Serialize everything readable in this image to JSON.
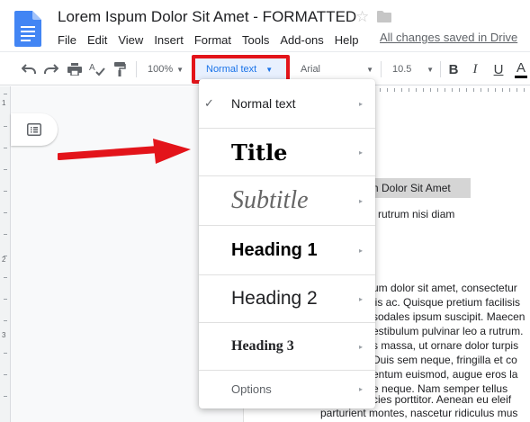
{
  "app": {
    "doc_title": "Lorem Ispum Dolor Sit Amet - FORMATTED",
    "save_status": "All changes saved in Drive",
    "logo_icon": "google-docs-logo",
    "colors": {
      "accent": "#1a73e8",
      "highlight_border": "#e3141a",
      "arrow": "#e3141a",
      "logo": "#4285f4"
    }
  },
  "menubar": [
    "File",
    "Edit",
    "View",
    "Insert",
    "Format",
    "Tools",
    "Add-ons",
    "Help"
  ],
  "toolbar": {
    "zoom": "100%",
    "style": "Normal text",
    "font": "Arial",
    "font_size": "10.5",
    "bold_label": "B",
    "italic_label": "I",
    "underline_label": "U",
    "text_color_label": "A"
  },
  "ruler": {
    "vertical_labels": [
      "1",
      "2",
      "3"
    ]
  },
  "style_menu": {
    "items": [
      {
        "label": "Normal text",
        "checked": true
      },
      {
        "label": "Title"
      },
      {
        "label": "Subtitle"
      },
      {
        "label": "Heading 1"
      },
      {
        "label": "Heading 2"
      },
      {
        "label": "Heading 3"
      },
      {
        "label": "Options"
      }
    ],
    "check_icon": "✓",
    "submenu_icon": "▸"
  },
  "document": {
    "highlighted": "um Dolor Sit Amet",
    "lines": [
      "se rutrum nisi diam",
      "um dolor sit amet, consectetur",
      "lis ac. Quisque pretium facilisis",
      "sodales ipsum suscipit. Maecen",
      "estibulum pulvinar leo a rutrum.",
      "s massa, ut ornare dolor turpis",
      "Duis sem neque, fringilla et co",
      "entum euismod, augue eros la",
      "e neque. Nam semper tellus",
      "cies porttitor. Aenean eu eleif",
      "parturient montes, nascetur ridiculus mus"
    ]
  }
}
